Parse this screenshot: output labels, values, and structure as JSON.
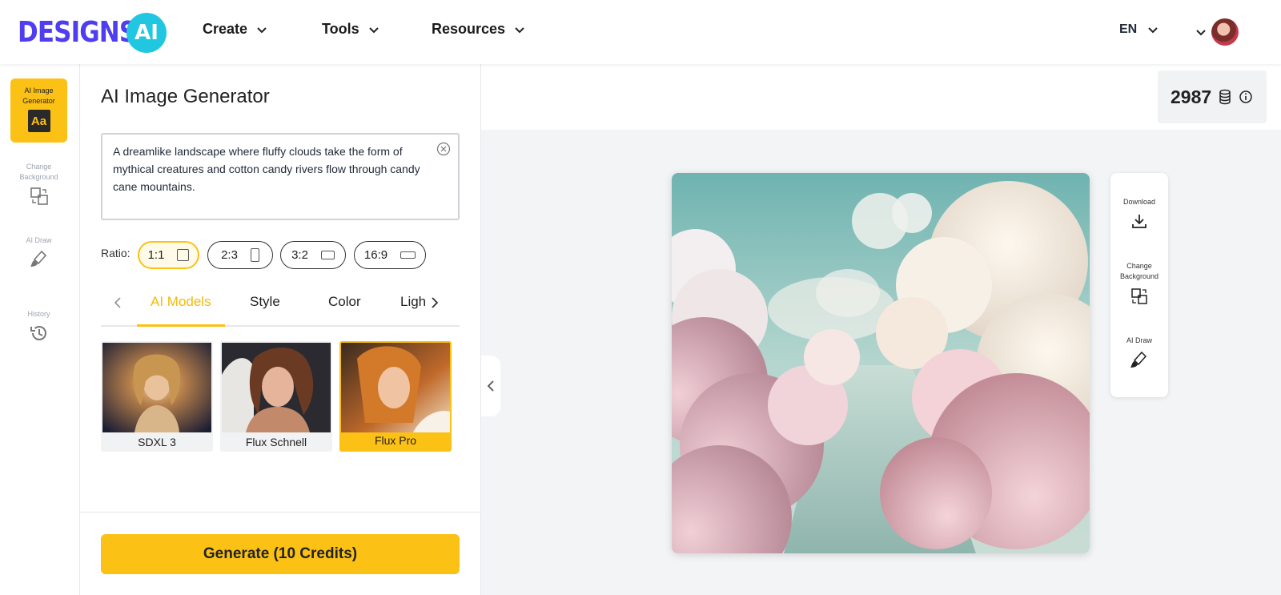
{
  "brand": {
    "logo_text": "DESIGNS.",
    "logo_badge": "AI"
  },
  "nav": {
    "items": [
      {
        "label": "Create"
      },
      {
        "label": "Tools"
      },
      {
        "label": "Resources"
      }
    ],
    "language": "EN"
  },
  "rail": {
    "items": [
      {
        "label": "AI Image Generator",
        "icon": "Aa"
      },
      {
        "label": "Change Background"
      },
      {
        "label": "AI Draw"
      },
      {
        "label": "History"
      }
    ]
  },
  "panel": {
    "title": "AI Image Generator",
    "prompt": "A dreamlike landscape where fluffy clouds take the form of mythical creatures and cotton candy rivers flow through candy cane mountains.",
    "ratio_label": "Ratio:",
    "ratios": [
      "1:1",
      "2:3",
      "3:2",
      "16:9"
    ],
    "selected_ratio": "1:1",
    "tabs": [
      "AI Models",
      "Style",
      "Color",
      "Ligh"
    ],
    "active_tab": "AI Models",
    "models": [
      "SDXL 3",
      "Flux Schnell",
      "Flux Pro"
    ],
    "selected_model": "Flux Pro",
    "generate_label": "Generate (10 Credits)"
  },
  "credits": {
    "value": "2987"
  },
  "side_tools": [
    {
      "label": "Download"
    },
    {
      "label": "Change Background"
    },
    {
      "label": "AI Draw"
    }
  ],
  "colors": {
    "accent": "#fbc115",
    "brand": "#4f3df0",
    "brand_badge": "#21c7e0"
  }
}
